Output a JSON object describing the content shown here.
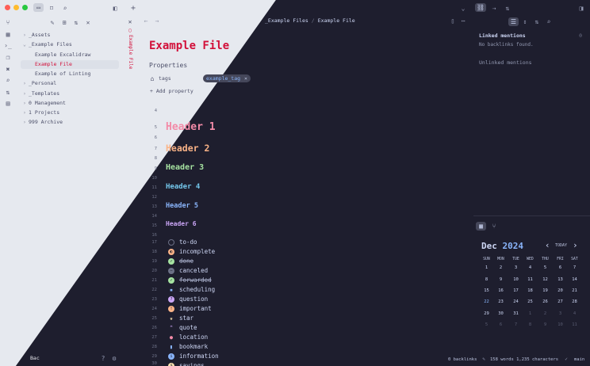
{
  "file_tree": {
    "items": [
      {
        "label": "_Assets",
        "type": "folder",
        "open": false,
        "depth": 0
      },
      {
        "label": "_Example Files",
        "type": "folder",
        "open": true,
        "depth": 0
      },
      {
        "label": "Example Excalidraw",
        "type": "file",
        "depth": 1
      },
      {
        "label": "Example File",
        "type": "file",
        "depth": 1,
        "active": true
      },
      {
        "label": "Example of Linting",
        "type": "file",
        "depth": 1
      },
      {
        "label": "_Personal",
        "type": "folder",
        "open": false,
        "depth": 0
      },
      {
        "label": "_Templates",
        "type": "folder",
        "open": false,
        "depth": 0
      },
      {
        "label": "0 Management",
        "type": "folder",
        "open": false,
        "depth": 0
      },
      {
        "label": "1 Projects",
        "type": "folder",
        "open": false,
        "depth": 0
      },
      {
        "label": "999 Archive",
        "type": "folder",
        "open": false,
        "depth": 0
      }
    ],
    "vault_name": "Bac"
  },
  "tab": {
    "vertical_title": "Example File"
  },
  "breadcrumb": {
    "folder": "_Example Files",
    "separator": "/",
    "file": "Example File"
  },
  "note": {
    "title": "Example File",
    "properties_heading": "Properties",
    "property_name": "tags",
    "tag_value": "example_tag",
    "tag_remove": "×",
    "add_property": "Add property",
    "line_numbers": [
      "4",
      "5",
      "6",
      "7",
      "8",
      "9",
      "10",
      "11",
      "12",
      "13",
      "14",
      "15",
      "16",
      "17",
      "18",
      "19",
      "20",
      "21",
      "22",
      "23",
      "24",
      "25",
      "26",
      "27",
      "28",
      "29",
      "30"
    ],
    "headers": [
      "Header 1",
      "Header 2",
      "Header 3",
      "Header 4",
      "Header 5",
      "Header 6"
    ],
    "tasks": [
      {
        "label": "to-do",
        "icon": "circle-empty-icon",
        "color": "#45475a",
        "glyph": "",
        "strike": false
      },
      {
        "label": "incomplete",
        "icon": "half-circle-icon",
        "color": "#fab387",
        "glyph": "◐",
        "strike": false
      },
      {
        "label": "done",
        "icon": "check-circle-icon",
        "color": "#a6e3a1",
        "glyph": "✓",
        "strike": true
      },
      {
        "label": "canceled",
        "icon": "cancel-circle-icon",
        "color": "#6c7086",
        "glyph": "−",
        "strike": false
      },
      {
        "label": "forwarded",
        "icon": "forward-circle-icon",
        "color": "#a6e3a1",
        "glyph": "✓",
        "strike": true
      },
      {
        "label": "scheduling",
        "icon": "calendar-small-icon",
        "color": "#89b4fa",
        "glyph": "▪",
        "strike": false
      },
      {
        "label": "question",
        "icon": "question-icon",
        "color": "#cba6f7",
        "glyph": "?",
        "strike": false
      },
      {
        "label": "important",
        "icon": "exclamation-icon",
        "color": "#fab387",
        "glyph": "!",
        "strike": false
      },
      {
        "label": "star",
        "icon": "star-icon",
        "color": "#f9e2af",
        "glyph": "★",
        "strike": false
      },
      {
        "label": "quote",
        "icon": "quote-icon",
        "color": "#cba6f7",
        "glyph": "❝",
        "strike": false
      },
      {
        "label": "location",
        "icon": "location-pin-icon",
        "color": "#f38ba8",
        "glyph": "●",
        "strike": false
      },
      {
        "label": "bookmark",
        "icon": "bookmark-icon",
        "color": "#89b4fa",
        "glyph": "▮",
        "strike": false
      },
      {
        "label": "information",
        "icon": "info-icon",
        "color": "#89b4fa",
        "glyph": "i",
        "strike": false
      },
      {
        "label": "savings",
        "icon": "savings-icon",
        "color": "#f9e2af",
        "glyph": "$",
        "strike": false
      }
    ]
  },
  "backlinks": {
    "linked_title": "Linked mentions",
    "linked_count": "0",
    "no_backlinks": "No backlinks found.",
    "unlinked_title": "Unlinked mentions"
  },
  "calendar": {
    "month": "Dec",
    "year": "2024",
    "today_label": "TODAY",
    "prev": "‹",
    "next": "›",
    "weekdays": [
      "SUN",
      "MON",
      "TUE",
      "WED",
      "THU",
      "FRI",
      "SAT"
    ],
    "weeks": [
      [
        "1",
        "2",
        "3",
        "4",
        "5",
        "6",
        "7"
      ],
      [
        "8",
        "9",
        "10",
        "11",
        "12",
        "13",
        "14"
      ],
      [
        "15",
        "16",
        "17",
        "18",
        "19",
        "20",
        "21"
      ],
      [
        "22",
        "23",
        "24",
        "25",
        "26",
        "27",
        "28"
      ],
      [
        "29",
        "30",
        "31",
        "1",
        "2",
        "3",
        "4"
      ],
      [
        "5",
        "6",
        "7",
        "8",
        "9",
        "10",
        "11"
      ]
    ]
  },
  "status_bar": {
    "backlinks": "0 backlinks",
    "words": "158 words 1,235 characters",
    "branch": "main"
  },
  "colors": {
    "light_bg": "#e6e9ef",
    "dark_bg": "#1e1e2e",
    "title_red": "#d20f39",
    "h1": "#f38ba8",
    "h2": "#fab387",
    "h3": "#a6e3a1",
    "h4": "#74c7ec",
    "h5": "#89b4fa",
    "h6": "#cba6f7",
    "accent": "#89b4fa"
  }
}
